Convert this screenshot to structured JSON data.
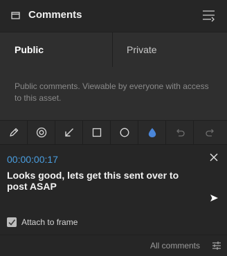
{
  "header": {
    "title": "Comments",
    "window_icon": "window-icon",
    "menu_icon": "menu-icon"
  },
  "tabs": [
    {
      "label": "Public",
      "active": true
    },
    {
      "label": "Private",
      "active": false
    }
  ],
  "info": {
    "text": "Public comments. Viewable by everyone with access to this asset."
  },
  "toolbar": {
    "tools": [
      {
        "icon": "pencil-icon"
      },
      {
        "icon": "target-icon"
      },
      {
        "icon": "arrow-icon"
      },
      {
        "icon": "rectangle-icon"
      },
      {
        "icon": "circle-icon"
      },
      {
        "icon": "color-drop-icon",
        "color": "#4a86d9"
      },
      {
        "icon": "undo-icon",
        "disabled": true
      },
      {
        "icon": "redo-icon",
        "disabled": true
      }
    ]
  },
  "comment": {
    "timecode": "00:00:00:17",
    "text": "Looks good, lets get this sent over to post ASAP"
  },
  "attach": {
    "label": "Attach to frame",
    "checked": true
  },
  "footer": {
    "all_comments": "All comments"
  },
  "colors": {
    "accent": "#4a9ee0",
    "background": "#262626",
    "panel": "#2f2f2f"
  }
}
